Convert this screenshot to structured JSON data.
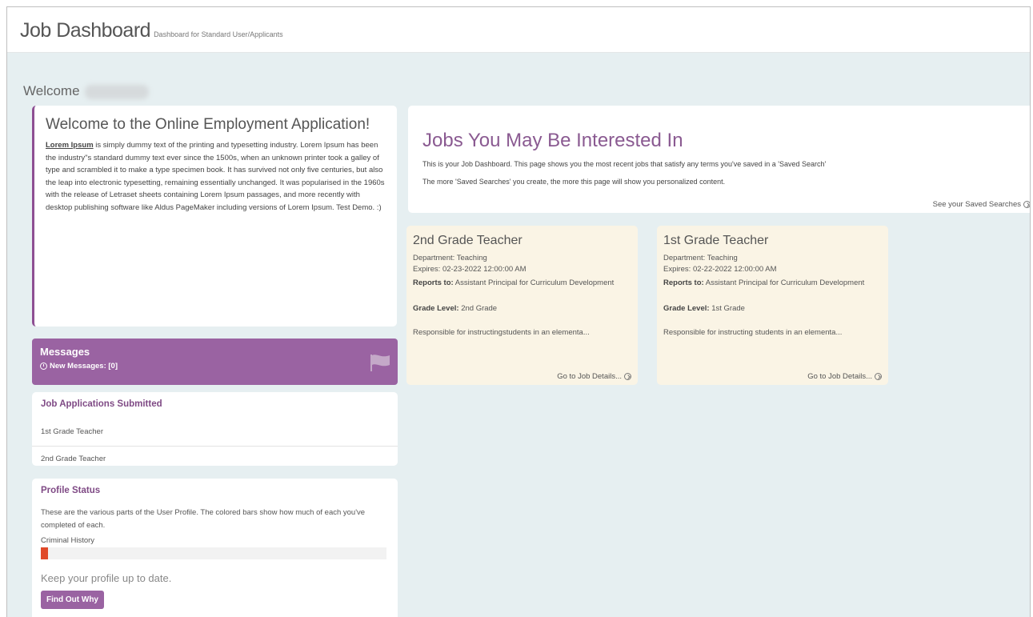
{
  "header": {
    "title": "Job Dashboard",
    "subtitle": "Dashboard for Standard User/Applicants"
  },
  "welcome": {
    "label": "Welcome"
  },
  "intro": {
    "heading": "Welcome to the Online Employment Application!",
    "lead": "Lorem Ipsum",
    "body": " is simply dummy text of the printing and typesetting industry. Lorem Ipsum has been the industry\"s standard dummy text ever since the 1500s, when an unknown printer took a galley of type and scrambled it to make a type specimen book. It has survived not only five centuries, but also the leap into electronic typesetting, remaining essentially unchanged. It was popularised in the 1960s with the release of Letraset sheets containing Lorem Ipsum passages, and more recently with desktop publishing software like Aldus PageMaker including versions of Lorem Ipsum. Test Demo. :)"
  },
  "messages": {
    "title": "Messages",
    "new_messages": "New Messages: [0]"
  },
  "applications": {
    "title": "Job Applications Submitted",
    "items": [
      "1st Grade Teacher",
      "2nd Grade Teacher"
    ]
  },
  "profile": {
    "title": "Profile Status",
    "description": "These are the various parts of the User Profile. The colored bars show how much of each you've completed of each.",
    "sections": [
      {
        "label": "Criminal History",
        "progress_fraction": 0.02
      }
    ],
    "keep_text": "Keep your profile up to date.",
    "find_out_label": "Find Out Why"
  },
  "jobs_intro": {
    "heading": "Jobs You May Be Interested In",
    "line1": "This is your Job Dashboard. This page shows you the most recent jobs that satisfy any terms you've saved in a 'Saved Search'",
    "line2": "The more 'Saved Searches' you create, the more this page will show you personalized content.",
    "saved_link": "See your Saved Searches"
  },
  "jobs": [
    {
      "title": "2nd Grade Teacher",
      "department": "Department: Teaching",
      "expires": "Expires: 02-23-2022 12:00:00 AM",
      "reports_label": "Reports to:",
      "reports_value": " Assistant Principal for Curriculum Development",
      "grade_label": "Grade Level:",
      "grade_value": " 2nd Grade",
      "summary": "Responsible for instructingstudents in an elementa...",
      "details_link": "Go to Job Details..."
    },
    {
      "title": "1st Grade Teacher",
      "department": "Department: Teaching",
      "expires": "Expires: 02-22-2022 12:00:00 AM",
      "reports_label": "Reports to:",
      "reports_value": " Assistant Principal for Curriculum Development",
      "grade_label": "Grade Level:",
      "grade_value": " 1st Grade",
      "summary": "Responsible for instructing students in an elementa...",
      "details_link": "Go to Job Details..."
    }
  ]
}
